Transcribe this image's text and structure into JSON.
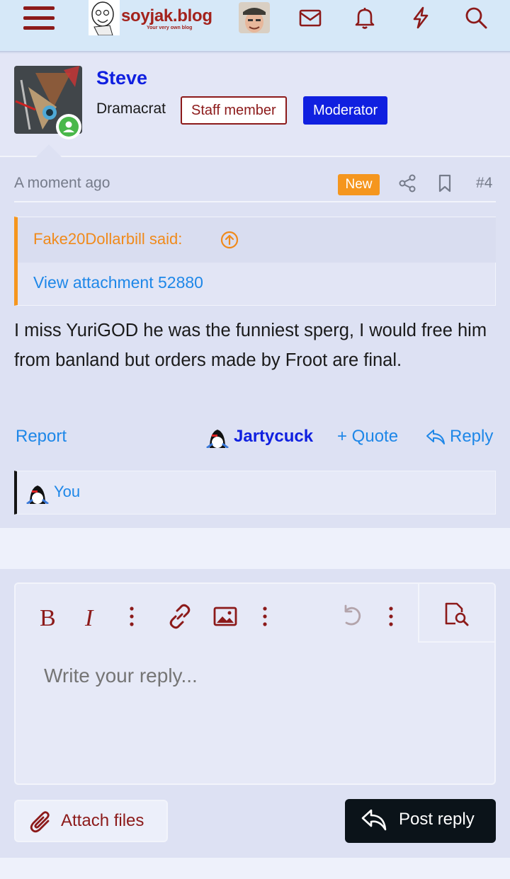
{
  "header": {
    "logo_text": "soyjak.blog",
    "logo_tagline": "Your very own blog",
    "icons": [
      "menu-icon",
      "mail-icon",
      "bell-icon",
      "lightning-icon",
      "search-icon"
    ]
  },
  "post": {
    "author": "Steve",
    "user_title": "Dramacrat",
    "badges": {
      "staff": "Staff member",
      "moderator": "Moderator"
    },
    "online": true,
    "date": "A moment ago",
    "new_label": "New",
    "number": "#4",
    "quote": {
      "author_said": "Fake20Dollarbill said:",
      "attachment_link": "View attachment 52880"
    },
    "body": "I miss YuriGOD he was the funniest sperg, I would free him from banland but orders made by Froot are final.",
    "actions": {
      "report": "Report",
      "reacting_user": "Jartycuck",
      "quote": "+ Quote",
      "reply": "Reply"
    },
    "reactions": {
      "label": "You"
    }
  },
  "editor": {
    "placeholder": "Write your reply...",
    "toolbar": [
      "bold-icon",
      "italic-icon",
      "more-options-icon",
      "link-icon",
      "image-icon",
      "more-options-icon",
      "undo-icon",
      "more-options-icon",
      "preview-icon"
    ]
  },
  "buttons": {
    "attach": "Attach files",
    "post_reply": "Post reply"
  },
  "colors": {
    "brand": "#8c1a1a",
    "accent_blue": "#1020e0",
    "link_blue": "#1e87e8",
    "quote_orange": "#f5961e",
    "online_green": "#49b84a"
  }
}
